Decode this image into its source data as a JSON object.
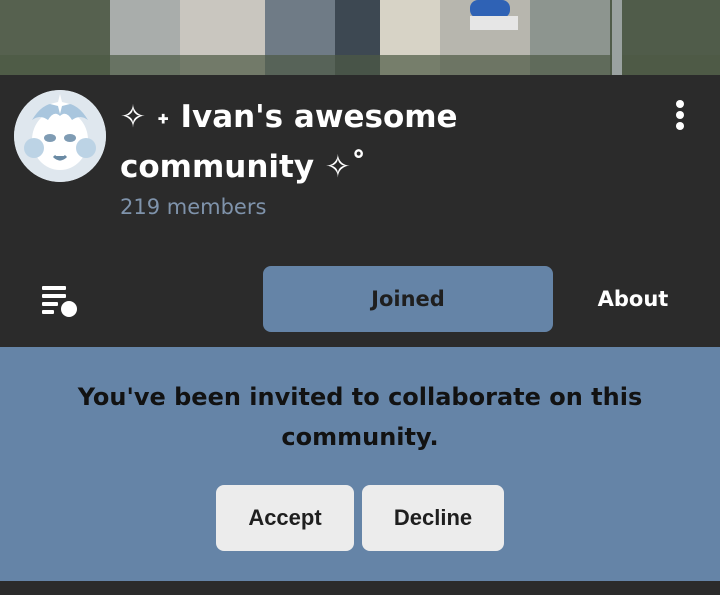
{
  "community": {
    "title_line1": "✧ ˖ Ivan's awesome",
    "title_line2": "community ✧˚",
    "members": "219 members"
  },
  "tabs": {
    "joined": "Joined",
    "about": "About"
  },
  "invite": {
    "message": "You've been invited to collaborate on this community.",
    "accept": "Accept",
    "decline": "Decline"
  },
  "icons": {
    "menu": "kebab-icon",
    "queue": "queue-list-icon"
  },
  "colors": {
    "accent": "#6584a7",
    "background": "#2b2b2b",
    "members_text": "#7f93ab"
  }
}
